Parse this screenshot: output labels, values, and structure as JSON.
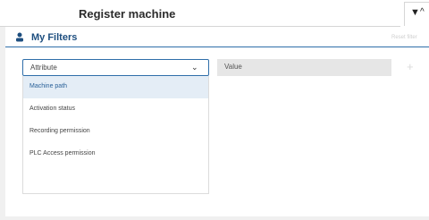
{
  "header": {
    "title": "Register machine",
    "filter_icon": "filter-icon",
    "collapse_icon": "chevron-up-icon"
  },
  "filters": {
    "title": "My Filters",
    "title_icon": "person-icon",
    "reset_label": "Reset filter",
    "attribute_select": {
      "label": "Attribute",
      "icon": "chevron-down-icon",
      "options": [
        {
          "label": "Machine path",
          "highlighted": true
        },
        {
          "label": "Activation status",
          "highlighted": false
        },
        {
          "label": "Recording permission",
          "highlighted": false
        },
        {
          "label": "PLC Access permission",
          "highlighted": false
        }
      ]
    },
    "value_field": {
      "label": "Value"
    },
    "add_button": {
      "label": "+",
      "icon": "plus-icon"
    }
  },
  "colors": {
    "accent": "#2f6ea9",
    "title_text": "#1d4e7f",
    "highlight_bg": "#e4edf6",
    "background": "#f0f0f0"
  }
}
